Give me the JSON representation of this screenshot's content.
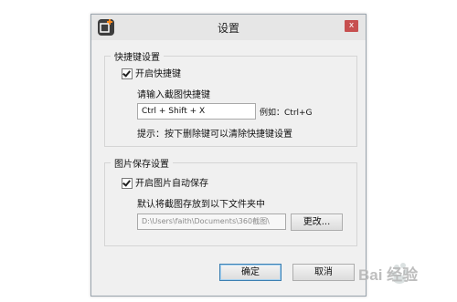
{
  "dialog": {
    "title": "设置",
    "close_glyph": "x",
    "icon": "scissors-plus-app-icon"
  },
  "shortcut_group": {
    "legend": "快捷键设置",
    "enable_label": "开启快捷键",
    "enable_checked": true,
    "prompt": "请输入截图快捷键",
    "shortcut_value": "Ctrl + Shift + X",
    "example": "例如：Ctrl+G",
    "hint": "提示：按下删除键可以清除快捷键设置"
  },
  "save_group": {
    "legend": "图片保存设置",
    "enable_label": "开启图片自动保存",
    "enable_checked": true,
    "folder_prompt": "默认将截图存放到以下文件夹中",
    "path_value": "D:\\Users\\faith\\Documents\\360截图\\",
    "change_button": "更改..."
  },
  "buttons": {
    "ok": "确定",
    "cancel": "取消"
  },
  "watermark": {
    "text": "Bai 经验"
  }
}
